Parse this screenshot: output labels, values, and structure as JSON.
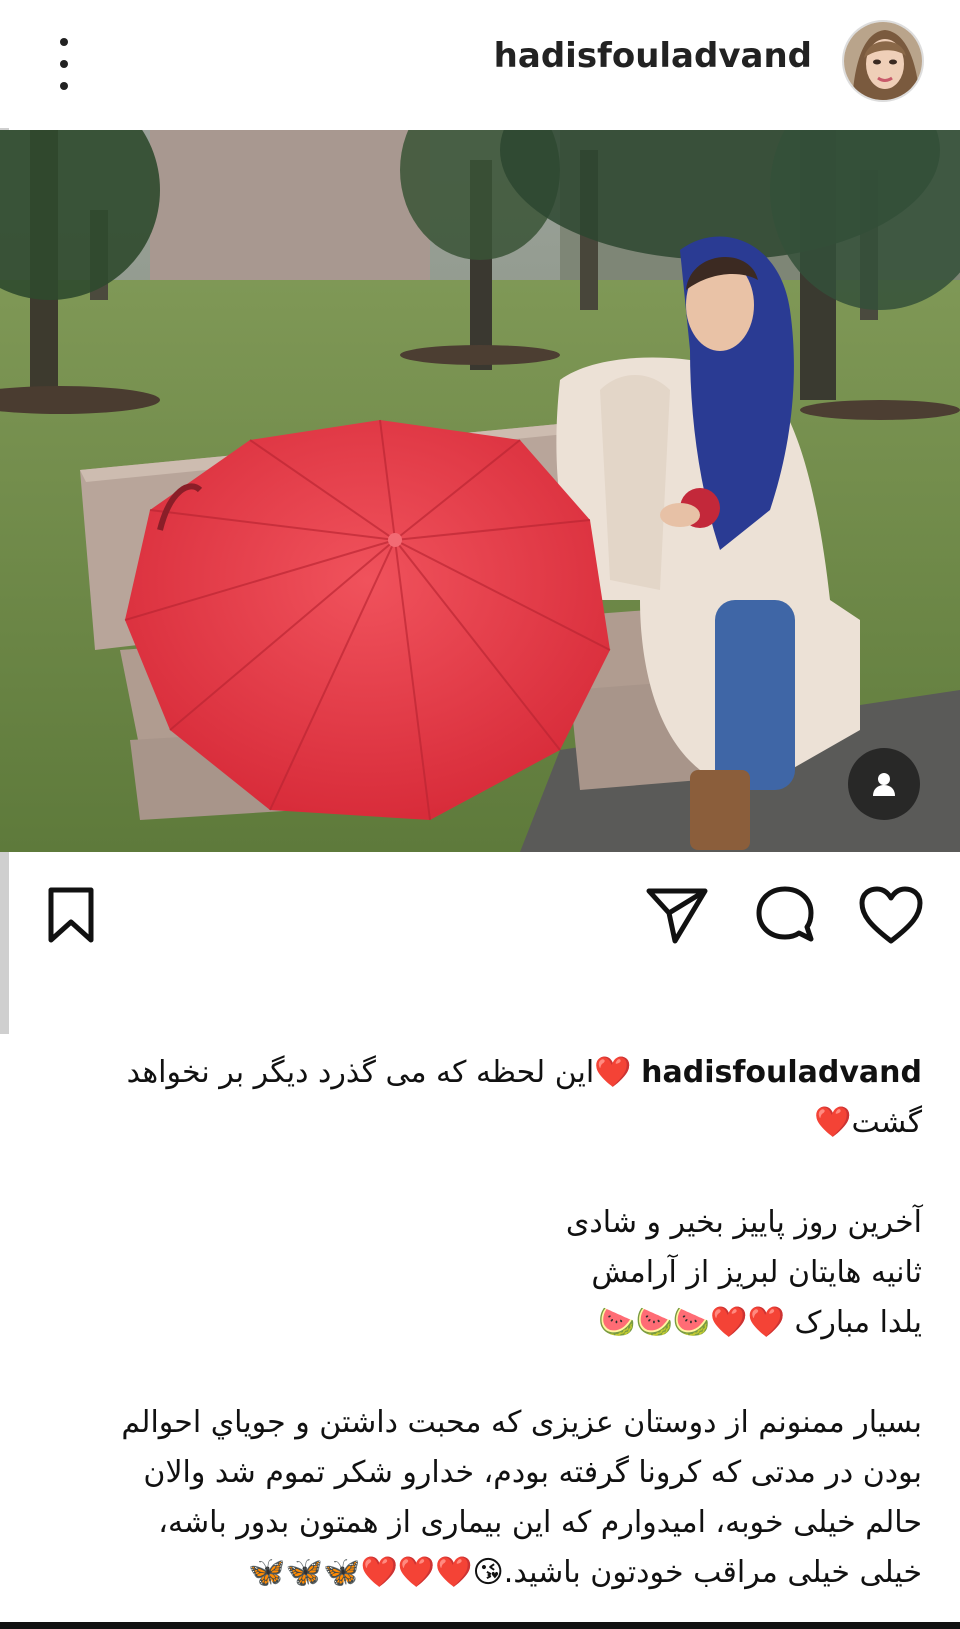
{
  "header": {
    "username": "hadisfouladvand"
  },
  "caption": {
    "username": "hadisfouladvand",
    "line1": "❤️این لحظه که می گذرد دیگر بر نخواهد",
    "line2": "گشت❤️",
    "line3": "آخرین روز پاییز بخیر و شادی",
    "line4": "ثانیه هایتان لبریز از آرامش",
    "line5": "یلدا مبارک ❤️❤️🍉🍉🍉",
    "line6": "بسیار ممنونم از دوستان عزیزی که محبت داشتن و جویاي احوالم",
    "line7": "بودن در مدتی که کرونا گرفته بودم، خدارو شکر تموم شد والان",
    "line8": "حالم خیلی خوبه، امیدوارم که این بیماری از همتون بدور باشه،",
    "line9": "خیلی خیلی مراقب خودتون باشید.😘❤️❤️❤️🦋🦋🦋"
  },
  "icons": {
    "more": "more-vertical-icon",
    "bookmark": "bookmark-icon",
    "share": "send-icon",
    "comment": "comment-icon",
    "like": "heart-icon",
    "tag": "user-tag-icon"
  },
  "colors": {
    "umbrella": "#e63a47",
    "scarf": "#2a3b93",
    "coat": "#ece1d6",
    "grass": "#6f8a45"
  }
}
